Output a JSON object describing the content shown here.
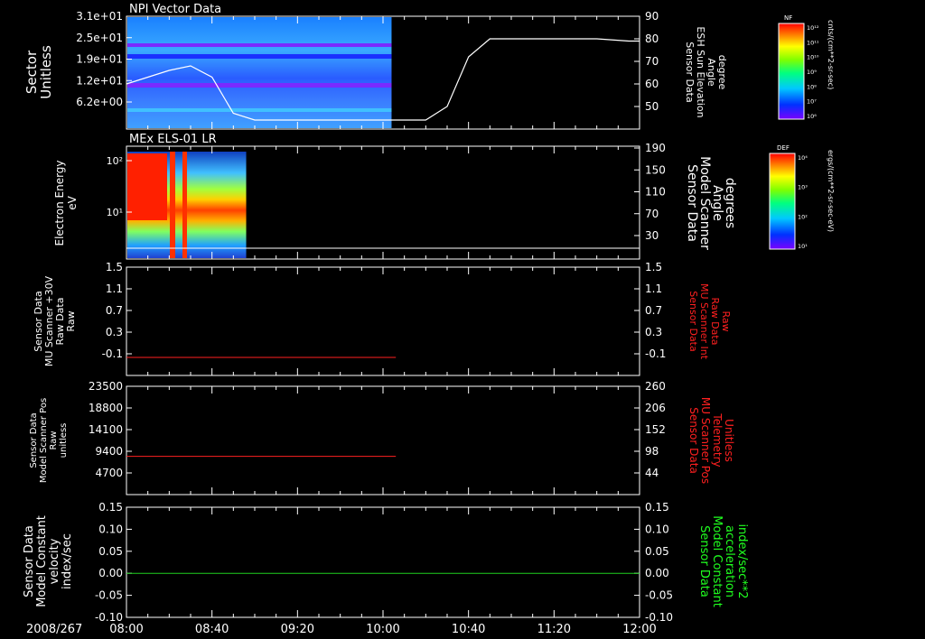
{
  "date_label": "2008/267",
  "time_ticks": [
    "08:00",
    "08:40",
    "09:20",
    "10:00",
    "10:40",
    "11:20",
    "12:00"
  ],
  "chart_data": [
    {
      "type": "heatmap",
      "title": "NPI Vector Data",
      "ylabel_left": [
        "Sector",
        "Unitless"
      ],
      "yticks_left": [
        "3.1e+01",
        "2.5e+01",
        "1.9e+01",
        "1.2e+01",
        "6.2e+00"
      ],
      "ylabel_right": [
        "Sensor Data",
        "ESH Sun Elevation",
        "Angle",
        "degree"
      ],
      "yticks_right": [
        "90",
        "80",
        "70",
        "60",
        "50"
      ],
      "ylim_right": [
        40,
        90
      ],
      "spectrogram_end_time": "10:04",
      "line_color": "#ffffff",
      "sun_elevation": {
        "time": [
          "08:00",
          "08:20",
          "08:30",
          "08:40",
          "08:50",
          "09:00",
          "10:20",
          "10:30",
          "10:40",
          "10:50",
          "11:00",
          "11:40",
          "11:55",
          "12:00"
        ],
        "values": [
          60,
          66,
          68,
          63,
          47,
          44,
          44,
          50,
          72,
          80,
          80,
          80,
          79,
          79
        ]
      },
      "colorbar": {
        "label": "NF",
        "units": "cnts/(cm**2-sr-sec)",
        "ticks": [
          "10¹²",
          "10¹¹",
          "10¹⁰",
          "10⁹",
          "10⁸",
          "10⁷",
          "10⁶"
        ]
      }
    },
    {
      "type": "heatmap",
      "title": "MEx ELS-01 LR",
      "ylabel_left": [
        "Electron Energy",
        "eV"
      ],
      "yticks_left": [
        "10²",
        "10¹"
      ],
      "ylabel_right": [
        "Sensor Data",
        "Model Scanner",
        "Angle",
        "degrees"
      ],
      "yticks_right": [
        "190",
        "150",
        "110",
        "70",
        "30"
      ],
      "spectrogram_end_time": "08:56",
      "line_color": "#ffffff",
      "scanner_angle": {
        "time": [
          "08:00",
          "12:00"
        ],
        "values": [
          10,
          10
        ]
      },
      "colorbar": {
        "label": "DEF",
        "units": "ergs/(cm**2-sr-sec-eV)",
        "ticks": [
          "10⁴",
          "10³",
          "10²",
          "10¹"
        ]
      }
    },
    {
      "type": "line",
      "ylabel_left": [
        "Sensor Data",
        "MU Scanner +30V",
        "Raw Data",
        "Raw"
      ],
      "yticks_left": [
        "1.5",
        "1.1",
        "0.7",
        "0.3",
        "-0.1"
      ],
      "ylim": [
        -0.3,
        1.5
      ],
      "ylabel_right": [
        "Sensor Data",
        "MU Scanner Int",
        "Raw Data",
        "Raw"
      ],
      "yticks_right": [
        "1.5",
        "1.1",
        "0.7",
        "0.3",
        "-0.1"
      ],
      "right_label_color": "#ff2020",
      "series": [
        {
          "color": "#ff2020",
          "time": [
            "08:00",
            "10:06"
          ],
          "values": [
            0.0,
            0.0
          ]
        }
      ]
    },
    {
      "type": "line",
      "ylabel_left": [
        "Sensor Data",
        "Model Scanner Pos",
        "Raw",
        "unitless"
      ],
      "yticks_left": [
        "23500",
        "18800",
        "14100",
        "9400",
        "4700"
      ],
      "ylim": [
        0,
        23500
      ],
      "ylabel_right": [
        "Sensor Data",
        "MU Scanner Pos",
        "Telemetry",
        "Unitless"
      ],
      "yticks_right": [
        "260",
        "206",
        "152",
        "98",
        "44"
      ],
      "right_label_color": "#ff2020",
      "series": [
        {
          "color": "#ff2020",
          "time": [
            "08:00",
            "10:06"
          ],
          "values": [
            8300,
            8300
          ]
        }
      ]
    },
    {
      "type": "line",
      "ylabel_left": [
        "Sensor Data",
        "Model Constant",
        "velocity",
        "index/sec"
      ],
      "yticks_left": [
        "0.15",
        "0.10",
        "0.05",
        "0.00",
        "-0.05",
        "-0.10"
      ],
      "ylim": [
        -0.1,
        0.15
      ],
      "ylabel_right": [
        "Sensor Data",
        "Model Constant",
        "acceleration",
        "index/sec**2"
      ],
      "yticks_right": [
        "0.15",
        "0.10",
        "0.05",
        "0.00",
        "-0.05",
        "-0.10"
      ],
      "right_label_color": "#20ff20",
      "series": [
        {
          "color": "#20d020",
          "time": [
            "08:00",
            "12:00"
          ],
          "values": [
            0.0,
            0.0
          ]
        }
      ]
    }
  ]
}
